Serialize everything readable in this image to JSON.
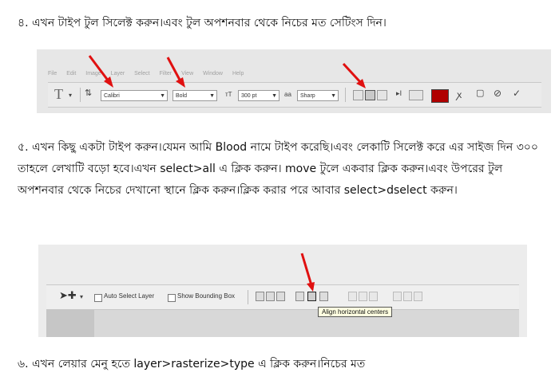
{
  "step4": {
    "text": "৪. এখন টাইপ টুল সিলেক্ট করুন।এবং টুল অপশনবার থেকে নিচের মত সেটিংস দিন।"
  },
  "step5": {
    "text": "৫. এখন কিছু একটা টাইপ করুন।যেমন আমি Blood নামে টাইপ করেছি।এবং লেকাটি সিলেক্ট করে এর সাইজ দিন ৩০০ তাহলে লেখাটি বড়ো হবে।এখন select>all এ ক্লিক করুন। move টুলে একবার ক্লিক করুন।এবং উপরের টুল অপশনবার থেকে নিচের দেখানো স্থানে ক্লিক করুন।ক্লিক করার পরে আবার select>dselect করুন।"
  },
  "step6": {
    "text": "৬. এখন লেয়ার মেনু হতে  layer>rasterize>type এ ক্লিক করুন।নিচের মত"
  },
  "type_toolbar": {
    "menu": [
      "File",
      "Edit",
      "Image",
      "Layer",
      "Select",
      "Filter",
      "View",
      "Window",
      "Help"
    ],
    "font_family": "Calibri",
    "font_style": "Bold",
    "font_size": "300 pt",
    "antialias": "Sharp",
    "text_color": "#b00000"
  },
  "move_toolbar": {
    "auto_select_label": "Auto Select Layer",
    "bounding_box_label": "Show Bounding Box",
    "tooltip": "Align horizontal centers"
  },
  "colors": {
    "arrow": "#e01010"
  }
}
